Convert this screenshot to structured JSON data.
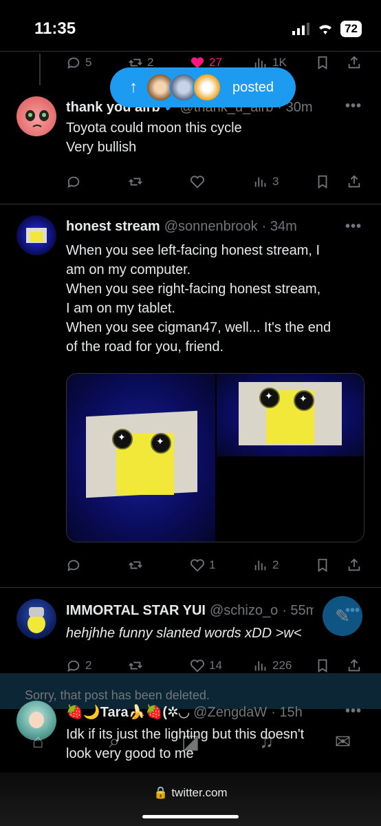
{
  "status_bar": {
    "time": "11:35",
    "battery": "72"
  },
  "top_actions": {
    "replies": "5",
    "reposts": "2",
    "likes": "27",
    "views": "1K"
  },
  "posted_pill": {
    "label": "posted",
    "arrow": "↑"
  },
  "tweets": [
    {
      "name": "thank you airb",
      "handle": "@thank_u_airb",
      "time": "· 30m",
      "lines": [
        "Toyota could moon this cycle",
        "Very bullish"
      ],
      "views": "3"
    },
    {
      "name": "honest stream",
      "handle": "@sonnenbrook",
      "time": "· 34m",
      "lines": [
        "When you see left-facing honest stream, I",
        "am on my computer.",
        "When you see right-facing honest stream,",
        "I am on my tablet.",
        "When you see cigman47, well... It's the end",
        "of the road for you, friend."
      ],
      "likes": "1",
      "views": "2"
    },
    {
      "name": "IMMORTAL STAR YUI",
      "handle": "@schizo_o",
      "time": "· 55m",
      "lines": [
        "hehjhhe funny slanted words xDD >w<"
      ],
      "replies": "2",
      "likes": "14",
      "views": "226"
    },
    {
      "name": "🍓🌙Tara🍌🍓(✲◡",
      "handle": "@ZengdaW",
      "time": "· 15h",
      "lines": [
        "Idk if its just the lighting but this doesn't",
        "look very good to me"
      ]
    }
  ],
  "deleted_notice": "Sorry, that post has been deleted.",
  "more_label": "•••",
  "url": "twitter.com",
  "colors": {
    "accent": "#1d9bf0",
    "like": "#f91880",
    "muted": "#71767b",
    "bg": "#000000"
  }
}
